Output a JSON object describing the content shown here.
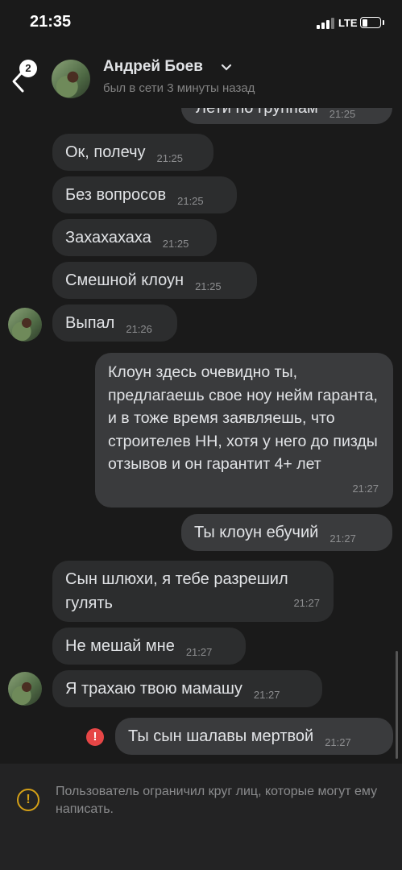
{
  "status": {
    "time": "21:35",
    "network": "LTE",
    "battery_level": 0.3
  },
  "header": {
    "unread_badge": "2",
    "name": "Андрей Боев",
    "last_seen": "был в сети 3 минуты назад",
    "icons": [
      "back-chevron",
      "dropdown-chevron"
    ]
  },
  "messages": [
    {
      "dir": "out",
      "text": "Лети по группам",
      "time": "21:25",
      "partial": true
    },
    {
      "dir": "in",
      "text": "Ок, полечу",
      "time": "21:25"
    },
    {
      "dir": "in",
      "text": "Без вопросов",
      "time": "21:25"
    },
    {
      "dir": "in",
      "text": "Захахахаха",
      "time": "21:25"
    },
    {
      "dir": "in",
      "text": "Смешной клоун",
      "time": "21:25"
    },
    {
      "dir": "in",
      "text": "Выпал",
      "time": "21:26",
      "avatar": true
    },
    {
      "dir": "out",
      "text": "Клоун здесь очевидно ты, предлагаешь свое ноу нейм гаранта, и в тоже время заявляешь, что строителев НН, хотя у него до пизды отзывов и он гарантит 4+ лет",
      "time": "21:27"
    },
    {
      "dir": "out",
      "text": "Ты клоун ебучий",
      "time": "21:27"
    },
    {
      "dir": "in",
      "text": "Сын шлюхи, я тебе разрешил гулять",
      "time": "21:27"
    },
    {
      "dir": "in",
      "text": "Не мешай мне",
      "time": "21:27"
    },
    {
      "dir": "in",
      "text": "Я трахаю твою мамашу",
      "time": "21:27",
      "avatar": true
    },
    {
      "dir": "out",
      "text": "Ты сын шалавы мертвой",
      "time": "21:27",
      "error": true
    }
  ],
  "error_mark": "!",
  "footer": {
    "notice": "Пользователь ограничил круг лиц, которые могут ему написать.",
    "warning_mark": "!"
  },
  "colors": {
    "background": "#1a1a1a",
    "incoming": "#2c2d2e",
    "outgoing": "#3a3b3d",
    "error": "#e64646",
    "warning": "#d4a017"
  }
}
